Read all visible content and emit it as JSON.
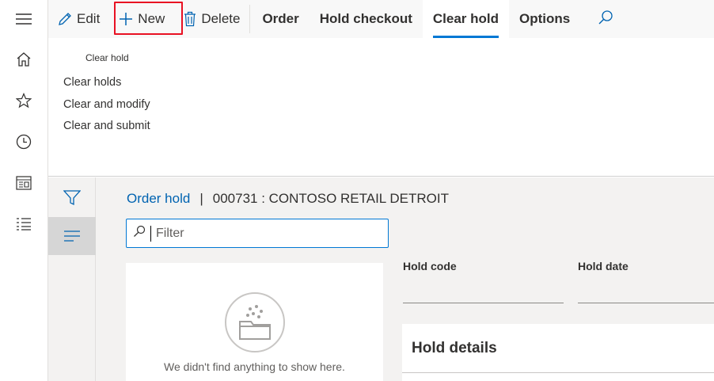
{
  "nav": {
    "items": [
      {
        "name": "hamburger-icon"
      },
      {
        "name": "home-icon"
      },
      {
        "name": "star-icon"
      },
      {
        "name": "clock-icon"
      },
      {
        "name": "workspace-icon"
      },
      {
        "name": "list-icon"
      }
    ]
  },
  "toolbar": {
    "edit_label": "Edit",
    "new_label": "New",
    "delete_label": "Delete",
    "tabs": [
      "Order",
      "Hold checkout",
      "Clear hold",
      "Options"
    ],
    "active_tab": "Clear hold",
    "accent_color": "#0078d4",
    "highlight_color": "#e81123"
  },
  "clear_hold_panel": {
    "group_title": "Clear hold",
    "items": [
      "Clear holds",
      "Clear and modify",
      "Clear and submit"
    ]
  },
  "breadcrumb": {
    "link": "Order hold",
    "separator": "|",
    "title": "000731 : CONTOSO RETAIL DETROIT"
  },
  "filter": {
    "placeholder": "Filter",
    "value": ""
  },
  "empty_state": {
    "message": "We didn't find anything to show here."
  },
  "fields": {
    "hold_code_label": "Hold code",
    "hold_date_label": "Hold date"
  },
  "details": {
    "title": "Hold details"
  }
}
